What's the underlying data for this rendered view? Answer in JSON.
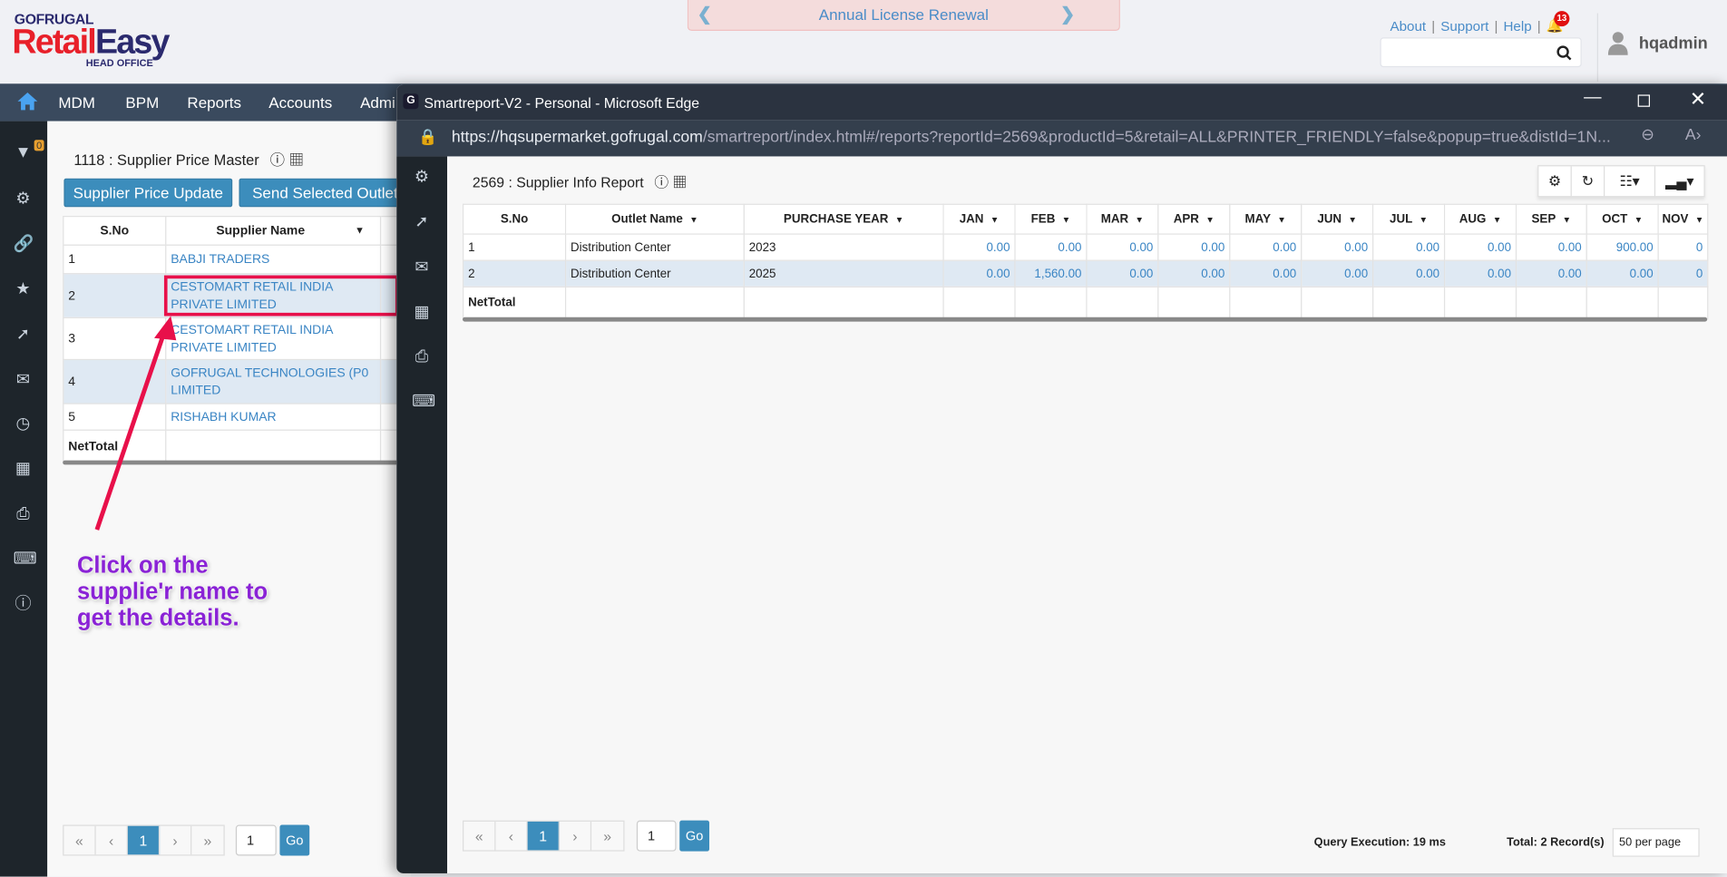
{
  "brand": {
    "top": "GOFRUGAL",
    "retail": "Retail",
    "easy": "Easy",
    "sub": "HEAD OFFICE"
  },
  "banner": {
    "text": "Annual License Renewal"
  },
  "toplinks": {
    "about": "About",
    "support": "Support",
    "help": "Help",
    "notifications": "13"
  },
  "search": {
    "placeholder": ""
  },
  "user": {
    "name": "hqadmin"
  },
  "nav": {
    "items": [
      "MDM",
      "BPM",
      "Reports",
      "Accounts",
      "Admi"
    ]
  },
  "sidebar": {
    "filter_badge": "0"
  },
  "left": {
    "title": "1118 : Supplier Price Master",
    "buttons": [
      "Supplier Price Update",
      "Send Selected Outlet"
    ],
    "columns": [
      "S.No",
      "Supplier Name"
    ],
    "rows": [
      [
        "1",
        "BABJI TRADERS"
      ],
      [
        "2",
        "CESTOMART RETAIL INDIA PRIVATE LIMITED"
      ],
      [
        "3",
        "CESTOMART RETAIL INDIA PRIVATE LIMITED"
      ],
      [
        "4",
        "GOFRUGAL TECHNOLOGIES (P0 LIMITED"
      ],
      [
        "5",
        "RISHABH KUMAR"
      ]
    ],
    "net_total": "NetTotal",
    "pagination": {
      "first": "«",
      "prev": "‹",
      "page": "1",
      "next": "›",
      "last": "»",
      "goto": "1",
      "go": "Go"
    }
  },
  "annotation": {
    "lines": [
      "Click on the",
      "supplie'r name to",
      "get the details."
    ]
  },
  "popup": {
    "window_title": "Smartreport-V2 - Personal - Microsoft Edge",
    "url_host": "https://hqsupermarket.gofrugal.com",
    "url_path": "/smartreport/index.html#/reports?reportId=2569&productId=5&retail=ALL&PRINTER_FRIENDLY=false&popup=true&distId=1N...",
    "title": "2569 : Supplier Info Report",
    "columns": [
      "S.No",
      "Outlet Name",
      "PURCHASE YEAR",
      "JAN",
      "FEB",
      "MAR",
      "APR",
      "MAY",
      "JUN",
      "JUL",
      "AUG",
      "SEP",
      "OCT",
      "NOV"
    ],
    "rows": [
      [
        "1",
        "Distribution Center",
        "2023",
        "0.00",
        "0.00",
        "0.00",
        "0.00",
        "0.00",
        "0.00",
        "0.00",
        "0.00",
        "0.00",
        "900.00",
        "0"
      ],
      [
        "2",
        "Distribution Center",
        "2025",
        "0.00",
        "1,560.00",
        "0.00",
        "0.00",
        "0.00",
        "0.00",
        "0.00",
        "0.00",
        "0.00",
        "0.00",
        "0"
      ]
    ],
    "net_total": "NetTotal",
    "pagination": {
      "first": "«",
      "prev": "‹",
      "page": "1",
      "next": "›",
      "last": "»",
      "goto": "1",
      "go": "Go"
    },
    "query_execution": "Query Execution: 19 ms",
    "total": "Total: 2 Record(s)",
    "per_page": "50 per page"
  },
  "colors": {
    "accent": "#3c8dbc",
    "nav": "#3a4a5e",
    "link": "#3a85c4",
    "annotation": "#8a22d6",
    "highlight": "#e8104a"
  }
}
